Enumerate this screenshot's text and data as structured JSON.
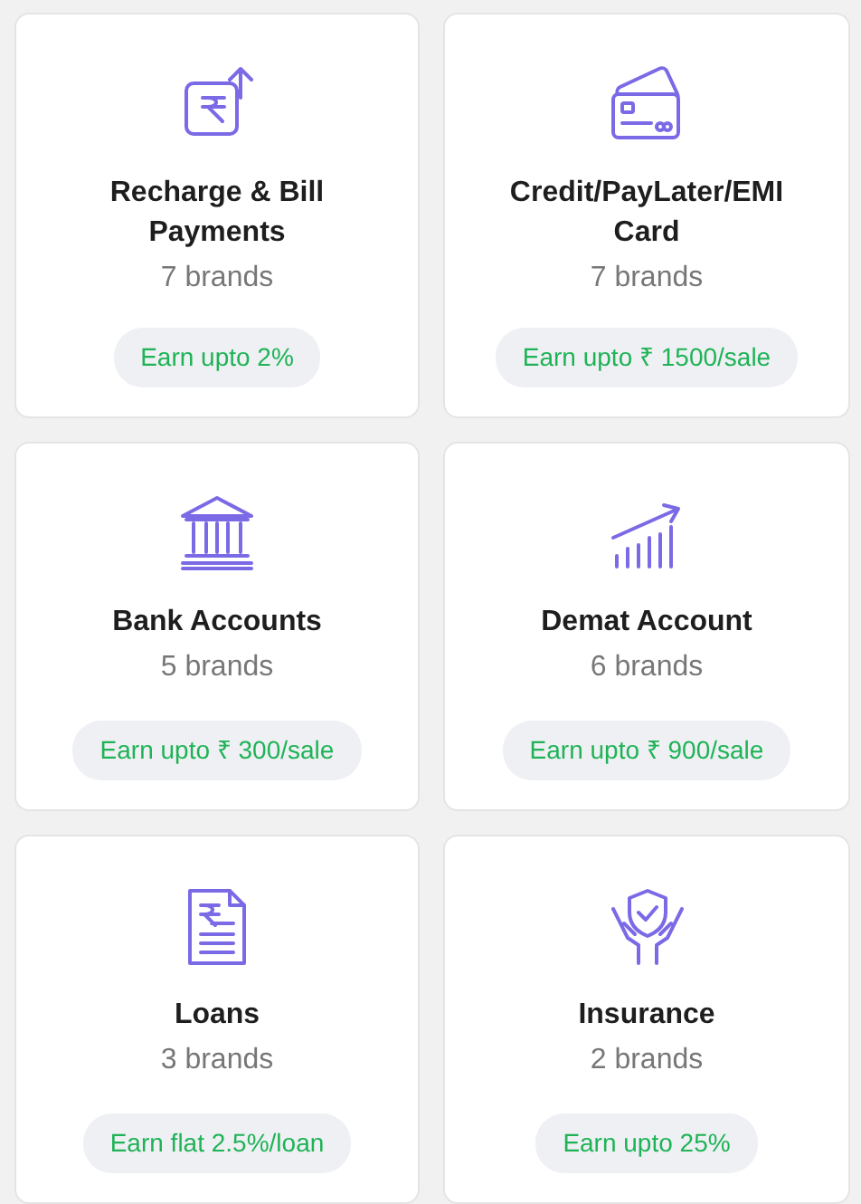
{
  "categories": [
    {
      "title": "Recharge & Bill Payments",
      "brands": "7 brands",
      "earn": "Earn upto 2%"
    },
    {
      "title": "Credit/PayLater/EMI Card",
      "brands": "7 brands",
      "earn": "Earn upto ₹ 1500/sale"
    },
    {
      "title": "Bank Accounts",
      "brands": "5 brands",
      "earn": "Earn upto ₹ 300/sale"
    },
    {
      "title": "Demat Account",
      "brands": "6 brands",
      "earn": "Earn upto ₹ 900/sale"
    },
    {
      "title": "Loans",
      "brands": "3 brands",
      "earn": "Earn flat 2.5%/loan"
    },
    {
      "title": "Insurance",
      "brands": "2 brands",
      "earn": "Earn upto 25%"
    }
  ]
}
